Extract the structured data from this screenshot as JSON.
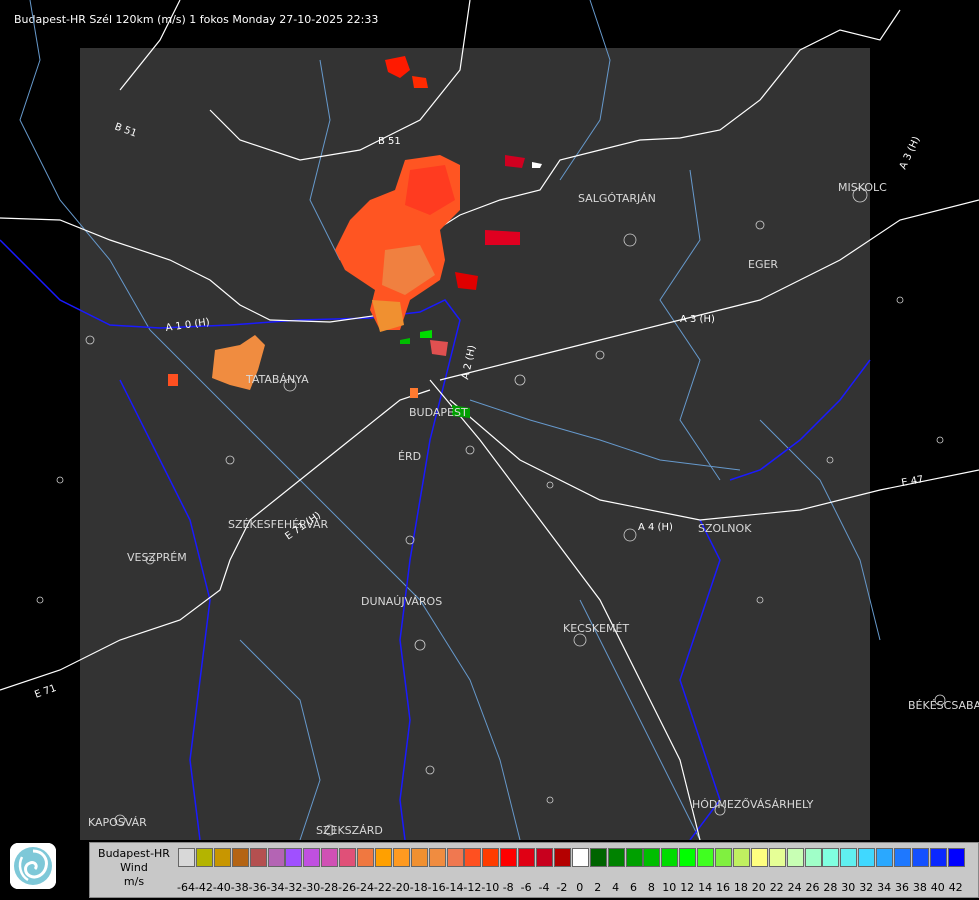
{
  "header": {
    "title": "Budapest-HR Szél 120km (m/s) 1 fokos Monday 27-10-2025 22:33"
  },
  "map": {
    "cities": [
      {
        "name": "SALGÓTARJÁN",
        "id": "salgotarjan"
      },
      {
        "name": "MISKOLC",
        "id": "miskolc"
      },
      {
        "name": "EGER",
        "id": "eger"
      },
      {
        "name": "TATABÁNYA",
        "id": "tatabanya"
      },
      {
        "name": "BUDAPEST",
        "id": "budapest"
      },
      {
        "name": "ÉRD",
        "id": "erd"
      },
      {
        "name": "SZÉKESFEHÉRVÁR",
        "id": "szekesfehervar"
      },
      {
        "name": "VESZPRÉM",
        "id": "veszprem"
      },
      {
        "name": "DUNAÚJVÁROS",
        "id": "dunaujvaros"
      },
      {
        "name": "KECSKEMÉT",
        "id": "kecskemet"
      },
      {
        "name": "SZOLNOK",
        "id": "szolnok"
      },
      {
        "name": "BÉKÉSCSABA",
        "id": "bekescsaba"
      },
      {
        "name": "HÓDMEZŐVÁSÁRHELY",
        "id": "hodmezovasarhely"
      },
      {
        "name": "KAPOSVÁR",
        "id": "kaposvar"
      },
      {
        "name": "SZEKSZÁRD",
        "id": "szekszard"
      }
    ],
    "roads": [
      {
        "name": "B 51",
        "id": "b51-a"
      },
      {
        "name": "B 51",
        "id": "b51-b"
      },
      {
        "name": "A 1 0 (H)",
        "id": "a10"
      },
      {
        "name": "A 2 (H)",
        "id": "a2"
      },
      {
        "name": "A 3 (H)",
        "id": "a3"
      },
      {
        "name": "A 3 (H)",
        "id": "a3-b"
      },
      {
        "name": "A 4 (H)",
        "id": "a4"
      },
      {
        "name": "E 47",
        "id": "e47"
      },
      {
        "name": "E 71 (H)",
        "id": "e71"
      },
      {
        "name": "E 71",
        "id": "e71-b"
      }
    ],
    "colors": {
      "coverage": "#333333",
      "borders": "#ffffff",
      "rivers": "#1a1aff",
      "county": "#6699cc"
    }
  },
  "legend": {
    "label_line1": "Budapest-HR",
    "label_line2": "Wind",
    "label_line3": "m/s",
    "levels": [
      {
        "v": "-64",
        "c": "#d8d8d8"
      },
      {
        "v": "-42",
        "c": "#b4b400"
      },
      {
        "v": "-40",
        "c": "#c89600"
      },
      {
        "v": "-38",
        "c": "#b46414"
      },
      {
        "v": "-36",
        "c": "#b45050"
      },
      {
        "v": "-34",
        "c": "#b464b4"
      },
      {
        "v": "-32",
        "c": "#a050ff"
      },
      {
        "v": "-30",
        "c": "#c050e0"
      },
      {
        "v": "-28",
        "c": "#d050b4"
      },
      {
        "v": "-26",
        "c": "#e05078"
      },
      {
        "v": "-24",
        "c": "#f07840"
      },
      {
        "v": "-22",
        "c": "#ffa000"
      },
      {
        "v": "-20",
        "c": "#ff9a20"
      },
      {
        "v": "-18",
        "c": "#f09030"
      },
      {
        "v": "-16",
        "c": "#f08c40"
      },
      {
        "v": "-14",
        "c": "#f07850"
      },
      {
        "v": "-12",
        "c": "#ff5020"
      },
      {
        "v": "-10",
        "c": "#ff3c00"
      },
      {
        "v": "-8",
        "c": "#ff0000"
      },
      {
        "v": "-6",
        "c": "#e00014"
      },
      {
        "v": "-4",
        "c": "#c8001e"
      },
      {
        "v": "-2",
        "c": "#b40000"
      },
      {
        "v": "0",
        "c": "#ffffff"
      },
      {
        "v": "2",
        "c": "#006400"
      },
      {
        "v": "4",
        "c": "#008200"
      },
      {
        "v": "6",
        "c": "#00a000"
      },
      {
        "v": "8",
        "c": "#00be00"
      },
      {
        "v": "10",
        "c": "#00dc00"
      },
      {
        "v": "12",
        "c": "#00ff00"
      },
      {
        "v": "14",
        "c": "#40ff20"
      },
      {
        "v": "16",
        "c": "#80f040"
      },
      {
        "v": "18",
        "c": "#c0f060"
      },
      {
        "v": "20",
        "c": "#ffff80"
      },
      {
        "v": "22",
        "c": "#e6ff96"
      },
      {
        "v": "24",
        "c": "#c8ffb4"
      },
      {
        "v": "26",
        "c": "#a0ffc8"
      },
      {
        "v": "28",
        "c": "#80ffe0"
      },
      {
        "v": "30",
        "c": "#60f0f0"
      },
      {
        "v": "32",
        "c": "#40d8ff"
      },
      {
        "v": "34",
        "c": "#2aa8ff"
      },
      {
        "v": "36",
        "c": "#1e78ff"
      },
      {
        "v": "38",
        "c": "#1450ff"
      },
      {
        "v": "40",
        "c": "#0a28ff"
      },
      {
        "v": "42",
        "c": "#0000ff"
      }
    ]
  }
}
